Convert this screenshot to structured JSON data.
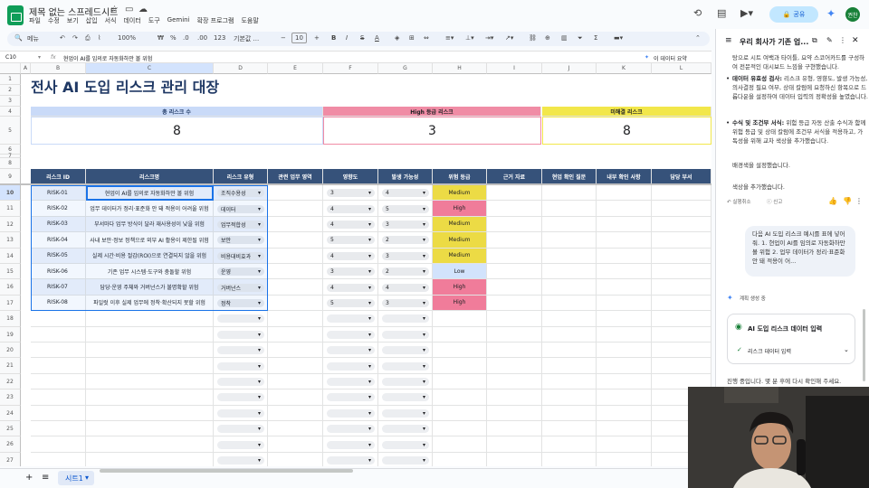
{
  "app": {
    "title": "제목 없는 스프레드시트",
    "menus": [
      "파일",
      "수정",
      "보기",
      "삽입",
      "서식",
      "데이터",
      "도구",
      "Gemini",
      "확장 프로그램",
      "도움말"
    ],
    "share": "공유",
    "avatar": "권찬"
  },
  "toolbar": {
    "menu": "메뉴",
    "zoom": "100%",
    "currency": "₩",
    "percent": "%",
    "dec_minus": ".0",
    "dec_plus": ".00",
    "num123": "123",
    "font": "기본값 ...",
    "font_size": "10",
    "gemini_btn": "이 데이터 요약"
  },
  "formula": {
    "cell_ref": "C10",
    "fx": "fx",
    "value": "현업이 AI를 임의로 자동화하만 볼 위험"
  },
  "columns": [
    "A",
    "B",
    "C",
    "D",
    "E",
    "F",
    "G",
    "H",
    "I",
    "J",
    "K",
    "L"
  ],
  "rows": [
    "1",
    "2",
    "3",
    "4",
    "5",
    "6",
    "7",
    "8",
    "9",
    "10",
    "11",
    "12",
    "13",
    "14",
    "15",
    "16",
    "17",
    "18",
    "19",
    "20",
    "21",
    "22",
    "23",
    "24",
    "25",
    "26",
    "27",
    "28"
  ],
  "sheet": {
    "title": "전사 AI 도입 리스크 관리 대장",
    "kpis": [
      {
        "label": "총 리스크 수",
        "value": "8"
      },
      {
        "label": "High 등급 리스크",
        "value": "3"
      },
      {
        "label": "미해결 리스크",
        "value": "8"
      }
    ],
    "headers": [
      "리스크 ID",
      "리스크명",
      "리스크 유형",
      "관련 업무 영역",
      "영향도",
      "발생 가능성",
      "위험 등급",
      "근거 자료",
      "현업 확인 질문",
      "내부 확인 사항",
      "담당 부서"
    ],
    "risks": [
      {
        "id": "RISK-01",
        "name": "현업이 AI를 임의로 자동화하만 볼 위험",
        "type": "조직수용성",
        "impact": "3",
        "likelihood": "4",
        "grade": "Medium"
      },
      {
        "id": "RISK-02",
        "name": "업무 데이터가 정리·표준화 안 돼 적용이 어려울 위험",
        "type": "데이터",
        "impact": "4",
        "likelihood": "5",
        "grade": "High"
      },
      {
        "id": "RISK-03",
        "name": "부서마다 업무 방식이 달라 재사용성이 낮을 위험",
        "type": "업무적합성",
        "impact": "4",
        "likelihood": "3",
        "grade": "Medium"
      },
      {
        "id": "RISK-04",
        "name": "사내 보안·정보 정책으로 외부 AI 활용이 제한될 위험",
        "type": "보안",
        "impact": "5",
        "likelihood": "2",
        "grade": "Medium"
      },
      {
        "id": "RISK-05",
        "name": "실제 시간·비용 절감(ROI)으로 연결되지 않을 위험",
        "type": "비용대비효과",
        "impact": "4",
        "likelihood": "3",
        "grade": "Medium"
      },
      {
        "id": "RISK-06",
        "name": "기존 업무 시스템·도구와 충돌할 위험",
        "type": "운영",
        "impact": "3",
        "likelihood": "2",
        "grade": "Low"
      },
      {
        "id": "RISK-07",
        "name": "담당·운영 주체와 거버넌스가 불명확할 위험",
        "type": "거버넌스",
        "impact": "4",
        "likelihood": "4",
        "grade": "High"
      },
      {
        "id": "RISK-08",
        "name": "파일럿 이후 실제 업무에 정착·확산되지 못할 위험",
        "type": "정착",
        "impact": "5",
        "likelihood": "3",
        "grade": "High"
      }
    ]
  },
  "sheetbar": {
    "add": "+",
    "list": "≡",
    "tab": "시트1"
  },
  "panel": {
    "title": "우리 회사가 기존 업...",
    "intro": "탕으로 시트 여백과 타이틀, 요약 스코어카드를 구성하여 전문적인 대시보드 느낌을 구현했습니다.",
    "b1_title": "데이터 유효성 검사:",
    "b1_text": "리스크 유형, 영향도, 발생 가능성, 의사결정 필요 여부, 상태 칼럼에 요청하신 항목으로 드롭다운을 설정하여 데이터 입력의 정확성을 높였습니다.",
    "b2_title": "수식 및 조건부 서식:",
    "b2_text": "위험 등급 자동 산출 수식과 함께 위험 등급 및 상태 칼럼에 조건부 서식을 적용하고, 가독성을 위해 교차 색상을 추가했습니다.",
    "p1": "배경색을 설정했습니다.",
    "p2": "색상을 추가했습니다.",
    "undo": "실행취소",
    "sources": "신고",
    "user_msg": "다음 AI 도입 리스크 예시를 표에 넣어줘. 1. 현업이 AI를 임의로 자동화하만 볼 위험 2. 업무 데이터가 정리·표준화 안 돼 적용이 어...",
    "plan": "계획 생성 중",
    "card_title": "AI 도입 리스크 데이터 입력",
    "card_step": "리스크 데이터 입력",
    "footer": "진행 중입니다. 몇 분 후에 다시 확인해 주세요."
  },
  "colors": {
    "high": "#f07c9a",
    "medium": "#ecdb45",
    "low": "#d2e3fc",
    "header": "#36527a",
    "kpi1": "#c9daf8",
    "kpi2": "#f08ca5",
    "kpi3": "#f2e74a"
  }
}
